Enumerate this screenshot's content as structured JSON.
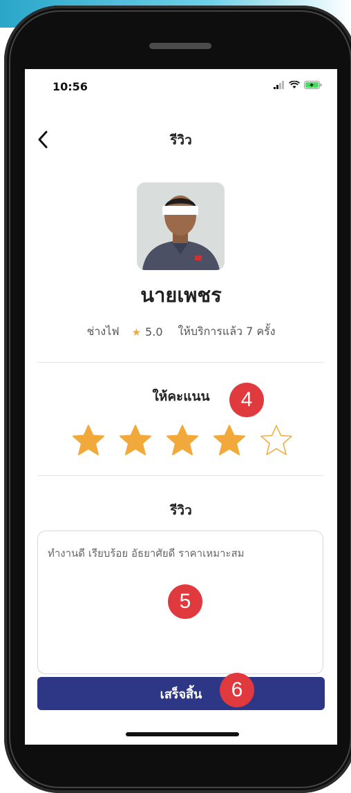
{
  "status_bar": {
    "time": "10:56"
  },
  "header": {
    "title": "รีวิว"
  },
  "profile": {
    "name": "นายเพชร",
    "profession": "ช่างไฟ",
    "rating": "5.0",
    "service_count": "ให้บริการแล้ว 7 ครั้ง"
  },
  "rating_section": {
    "label": "ให้คะแนน",
    "selected_stars": 4,
    "max_stars": 5
  },
  "review_section": {
    "label": "รีวิว",
    "text": "ทำงานดี เรียบร้อย อัธยาศัยดี ราคาเหมาะสม"
  },
  "submit": {
    "label": "เสร็จสิ้น"
  },
  "annotations": {
    "badge_rating": "4",
    "badge_review": "5",
    "badge_submit": "6"
  },
  "colors": {
    "star_filled": "#f2a93b",
    "submit_bg": "#2e3786",
    "badge": "#e13a3e"
  },
  "icons": {
    "back": "chevron-left-icon",
    "star": "star-icon"
  }
}
